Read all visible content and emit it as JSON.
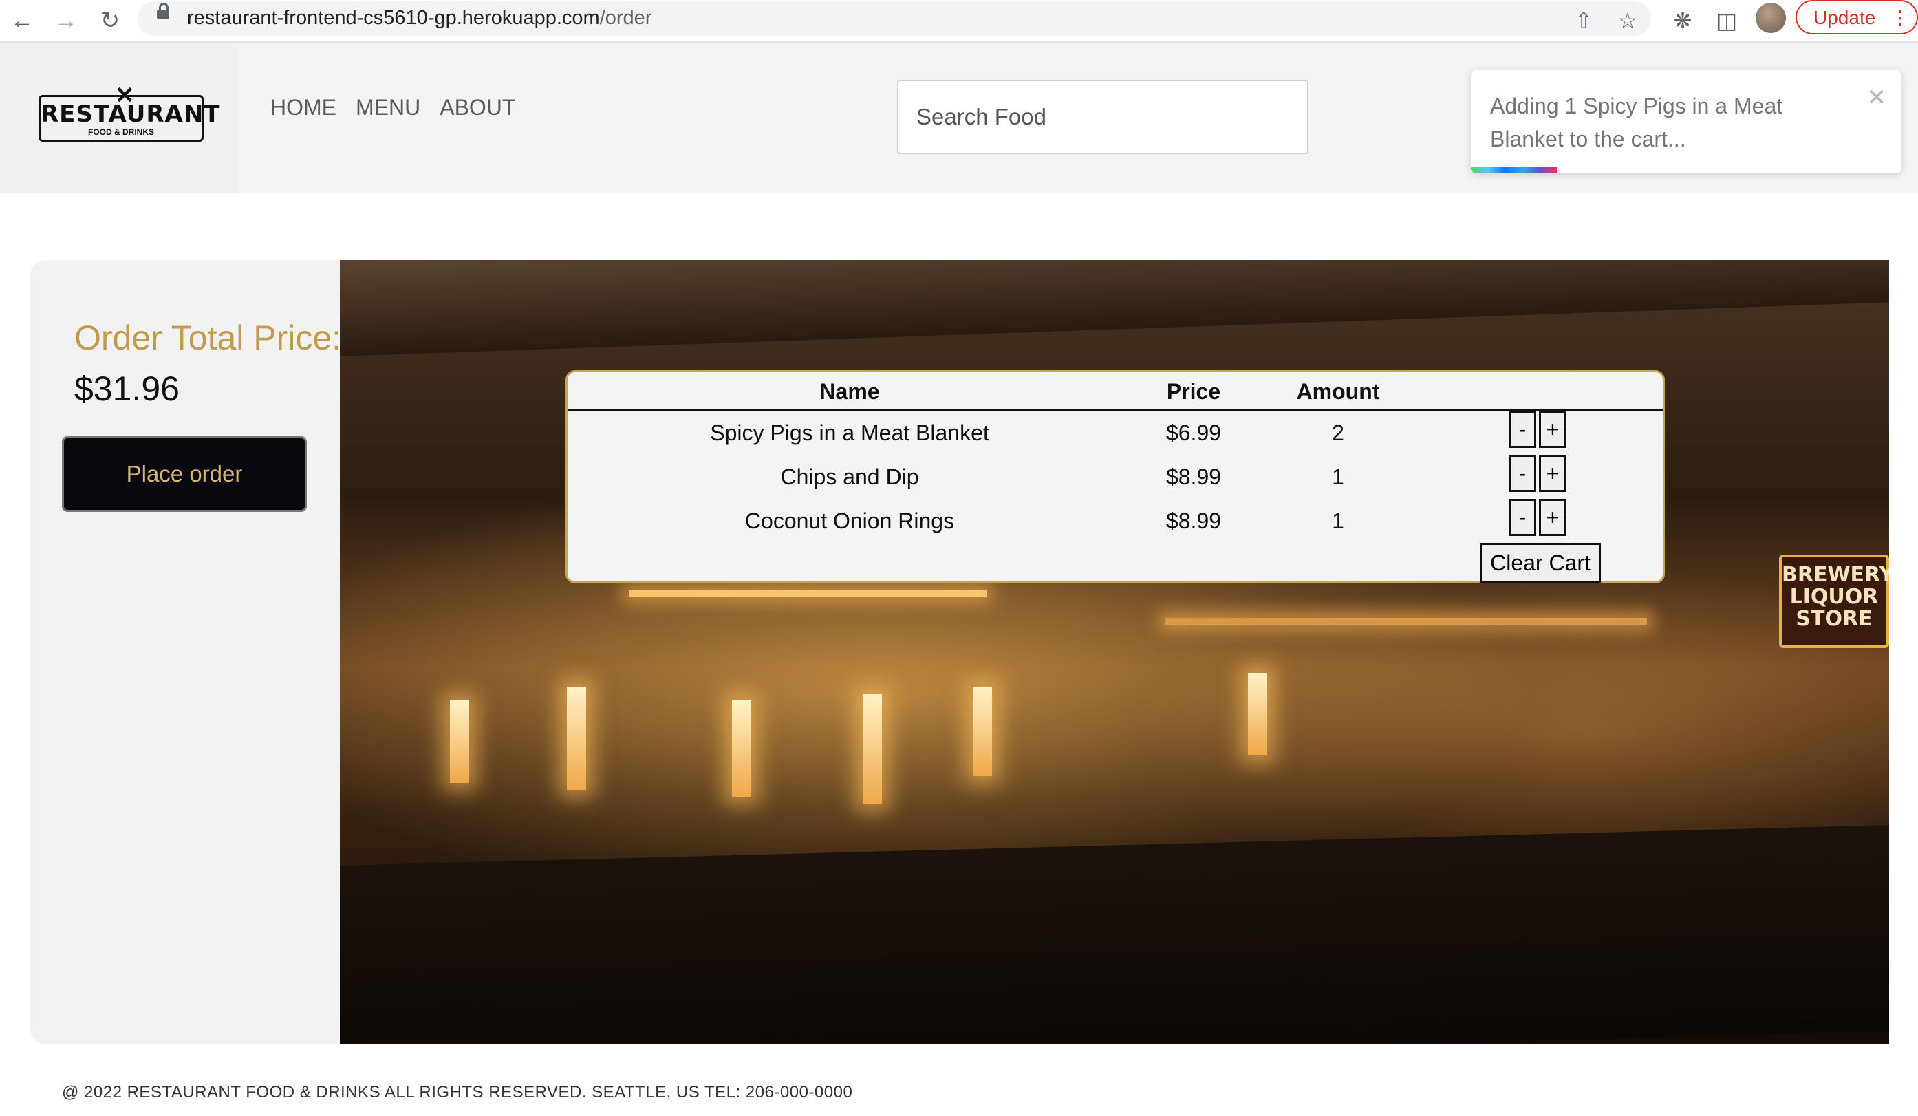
{
  "browser": {
    "url_host": "restaurant-frontend-cs5610-gp.herokuapp.com",
    "url_path": "/order",
    "update_label": "Update"
  },
  "header": {
    "logo_name": "RESTAURANT",
    "logo_tagline": "FOOD & DRINKS",
    "nav": [
      "HOME",
      "MENU",
      "ABOUT"
    ],
    "search_placeholder": "Search Food"
  },
  "toast": {
    "message": "Adding 1 Spicy Pigs in a Meat Blanket to the cart...",
    "progress": 0.2
  },
  "order": {
    "total_label": "Order Total Price:",
    "total_value": "$31.96",
    "place_order_label": "Place order"
  },
  "cart": {
    "columns": [
      "Name",
      "Price",
      "Amount"
    ],
    "rows": [
      {
        "name": "Spicy Pigs in a Meat Blanket",
        "price": "$6.99",
        "amount": "2"
      },
      {
        "name": "Chips and Dip",
        "price": "$8.99",
        "amount": "1"
      },
      {
        "name": "Coconut Onion Rings",
        "price": "$8.99",
        "amount": "1"
      }
    ],
    "minus_label": "-",
    "plus_label": "+",
    "clear_label": "Clear Cart"
  },
  "hero": {
    "sign_text": "BREWERY LIQUOR STORE"
  },
  "footer": {
    "text": "@ 2022 RESTAURANT FOOD & DRINKS ALL RIGHTS RESERVED. SEATTLE, US TEL: 206-000-0000"
  },
  "colors": {
    "accent_gold": "#c29a4b",
    "button_dark": "#07090f"
  }
}
